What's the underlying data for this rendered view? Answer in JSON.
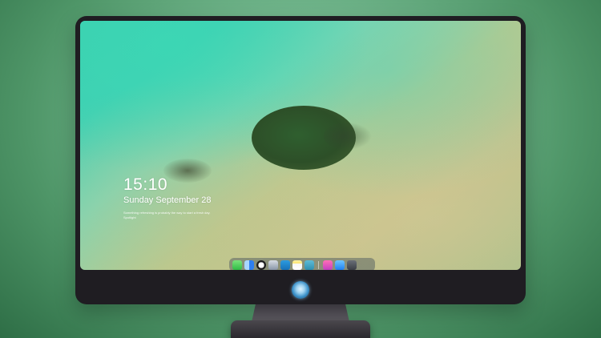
{
  "lockscreen": {
    "time": "15:10",
    "date": "Sunday September 28",
    "note": "Something refreshing is probably the way to start a fresh day. Spotlight"
  },
  "dock": {
    "apps": [
      {
        "name": "Messages",
        "icon": "messages-icon"
      },
      {
        "name": "Finder",
        "icon": "finder-icon"
      },
      {
        "name": "Safari",
        "icon": "safari-icon"
      },
      {
        "name": "Preview",
        "icon": "preview-icon"
      },
      {
        "name": "Clapper",
        "icon": "clapper-icon"
      },
      {
        "name": "Notes",
        "icon": "notes-icon"
      },
      {
        "name": "Photos",
        "icon": "photos-icon"
      },
      {
        "name": "Music",
        "icon": "music-icon"
      },
      {
        "name": "App Store",
        "icon": "app-store-icon"
      },
      {
        "name": "Camera",
        "icon": "camera-icon"
      }
    ]
  },
  "colors": {
    "background": "#6fb48a",
    "monitor_bezel": "#1f1d22",
    "wallpaper_teal": "#3bcfb0",
    "wallpaper_sand": "#c8c38c"
  }
}
